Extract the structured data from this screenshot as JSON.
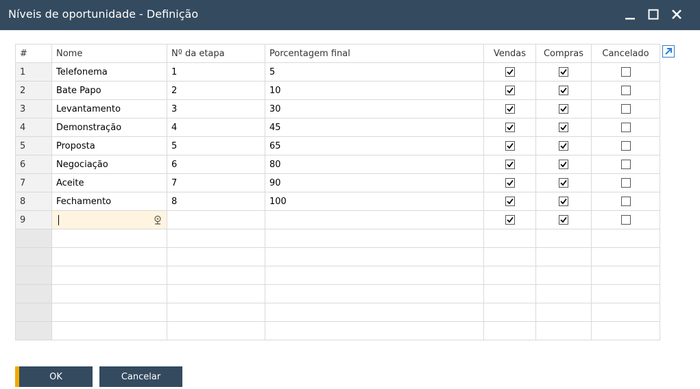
{
  "window": {
    "title": "Níveis de oportunidade - Definição"
  },
  "columns": {
    "num": "#",
    "nome": "Nome",
    "etapa": "Nº da etapa",
    "porcentagem": "Porcentagem final",
    "vendas": "Vendas",
    "compras": "Compras",
    "cancelado": "Cancelado"
  },
  "rows": [
    {
      "num": "1",
      "nome": "Telefonema",
      "etapa": "1",
      "porcentagem": "5",
      "vendas": true,
      "compras": true,
      "cancelado": false
    },
    {
      "num": "2",
      "nome": "Bate Papo",
      "etapa": "2",
      "porcentagem": "10",
      "vendas": true,
      "compras": true,
      "cancelado": false
    },
    {
      "num": "3",
      "nome": "Levantamento",
      "etapa": "3",
      "porcentagem": "30",
      "vendas": true,
      "compras": true,
      "cancelado": false
    },
    {
      "num": "4",
      "nome": "Demonstração",
      "etapa": "4",
      "porcentagem": "45",
      "vendas": true,
      "compras": true,
      "cancelado": false
    },
    {
      "num": "5",
      "nome": "Proposta",
      "etapa": "5",
      "porcentagem": "65",
      "vendas": true,
      "compras": true,
      "cancelado": false
    },
    {
      "num": "6",
      "nome": "Negociação",
      "etapa": "6",
      "porcentagem": "80",
      "vendas": true,
      "compras": true,
      "cancelado": false
    },
    {
      "num": "7",
      "nome": "Aceite",
      "etapa": "7",
      "porcentagem": "90",
      "vendas": true,
      "compras": true,
      "cancelado": false
    },
    {
      "num": "8",
      "nome": "Fechamento",
      "etapa": "8",
      "porcentagem": "100",
      "vendas": true,
      "compras": true,
      "cancelado": false
    },
    {
      "num": "9",
      "nome": "",
      "etapa": "",
      "porcentagem": "",
      "vendas": true,
      "compras": true,
      "cancelado": false
    }
  ],
  "empty_rows": 6,
  "buttons": {
    "ok": "OK",
    "cancel": "Cancelar"
  },
  "colors": {
    "titlebar": "#344a5f",
    "accent": "#f0ab00",
    "editing_cell": "#fff4e0"
  },
  "icons": {
    "minimize": "minimize-icon",
    "maximize": "maximize-icon",
    "close": "close-icon",
    "expand": "expand-arrow-icon",
    "lookup": "lookup-icon"
  }
}
